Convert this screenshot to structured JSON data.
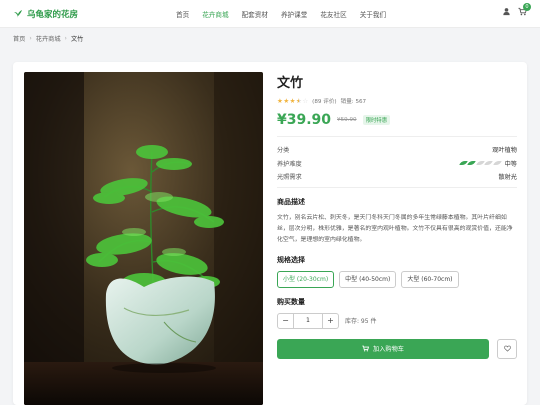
{
  "header": {
    "brand": "乌龟家的花房",
    "nav": [
      "首页",
      "花卉商城",
      "配套资材",
      "养护课堂",
      "花友社区",
      "关于我们"
    ],
    "active_nav": 1,
    "cart_count": "0",
    "icons": [
      "user-icon",
      "cart-icon"
    ]
  },
  "breadcrumb": {
    "home": "首页",
    "shop": "花卉商城",
    "current": "文竹"
  },
  "product": {
    "title": "文竹",
    "rating": 3.5,
    "reviews": "(89 评价)",
    "sales": "销量: 567",
    "price": "¥39.90",
    "old_price": "¥59.90",
    "promo": "限时特惠",
    "specs": [
      {
        "k": "分类",
        "v": "观叶植物"
      },
      {
        "k": "养护难度",
        "v": "中等",
        "level": 2,
        "max": 5
      },
      {
        "k": "光照需求",
        "v": "散射光"
      }
    ],
    "desc_title": "商品描述",
    "desc": "文竹，别名云片松、刺天冬，是天门冬科天门冬属的多年生常绿藤本植物。其叶片纤细如丝，层次分明，株形优雅，是著名的室内观叶植物。文竹不仅具有很高的观赏价值，还能净化空气，是理想的室内绿化植物。",
    "size_title": "规格选择",
    "sizes": [
      "小型 (20-30cm)",
      "中型 (40-50cm)",
      "大型 (60-70cm)"
    ],
    "selected_size": 0,
    "qty_title": "购买数量",
    "qty": "1",
    "stock": "库存: 95 件",
    "cart_btn": "加入购物车"
  },
  "colors": {
    "accent": "#3aa655",
    "price": "#3aa655",
    "star": "#f1b43e"
  }
}
